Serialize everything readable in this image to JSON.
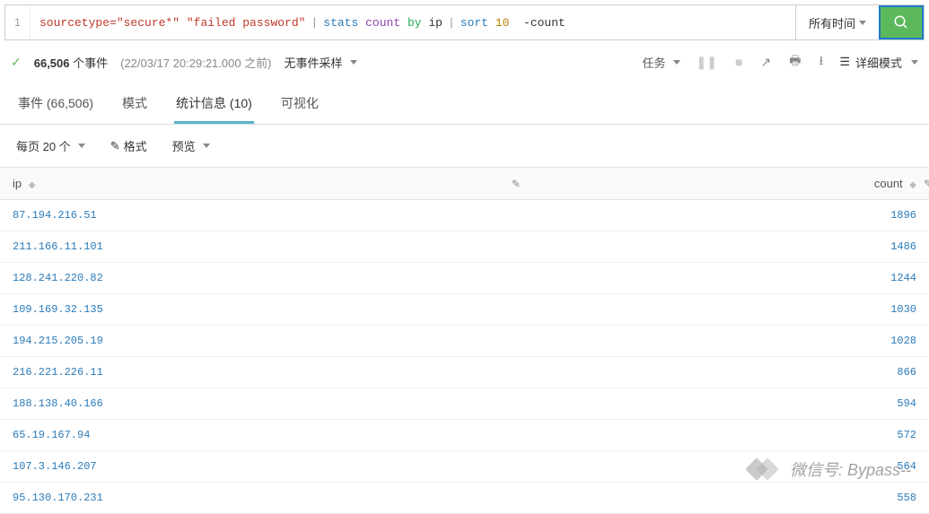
{
  "search": {
    "line": "1",
    "q_str1": "sourcetype=\"secure*\"",
    "q_str2": "\"failed password\"",
    "q_cmd1": "stats",
    "q_func": "count",
    "q_kw1": "by",
    "q_field": "ip",
    "q_cmd2": "sort",
    "q_num": "10",
    "q_op": "-count",
    "time_label": "所有时间"
  },
  "status": {
    "count": "66,506",
    "count_suffix": " 个事件",
    "timestamp": "(22/03/17 20:29:21.000 之前)",
    "sampling": "无事件采样",
    "task": "任务",
    "view_mode": "详细模式"
  },
  "tabs": {
    "events": "事件 (66,506)",
    "patterns": "模式",
    "stats": "统计信息 (10)",
    "viz": "可视化"
  },
  "toolbar": {
    "per_page": "每页 20 个",
    "format": "格式",
    "preview": "预览"
  },
  "table": {
    "headers": {
      "ip": "ip",
      "count": "count"
    },
    "rows": [
      {
        "ip": "87.194.216.51",
        "count": "1896"
      },
      {
        "ip": "211.166.11.101",
        "count": "1486"
      },
      {
        "ip": "128.241.220.82",
        "count": "1244"
      },
      {
        "ip": "109.169.32.135",
        "count": "1030"
      },
      {
        "ip": "194.215.205.19",
        "count": "1028"
      },
      {
        "ip": "216.221.226.11",
        "count": "866"
      },
      {
        "ip": "188.138.40.166",
        "count": "594"
      },
      {
        "ip": "65.19.167.94",
        "count": "572"
      },
      {
        "ip": "107.3.146.207",
        "count": "564"
      },
      {
        "ip": "95.130.170.231",
        "count": "558"
      }
    ]
  },
  "watermark": "微信号: Bypass--"
}
